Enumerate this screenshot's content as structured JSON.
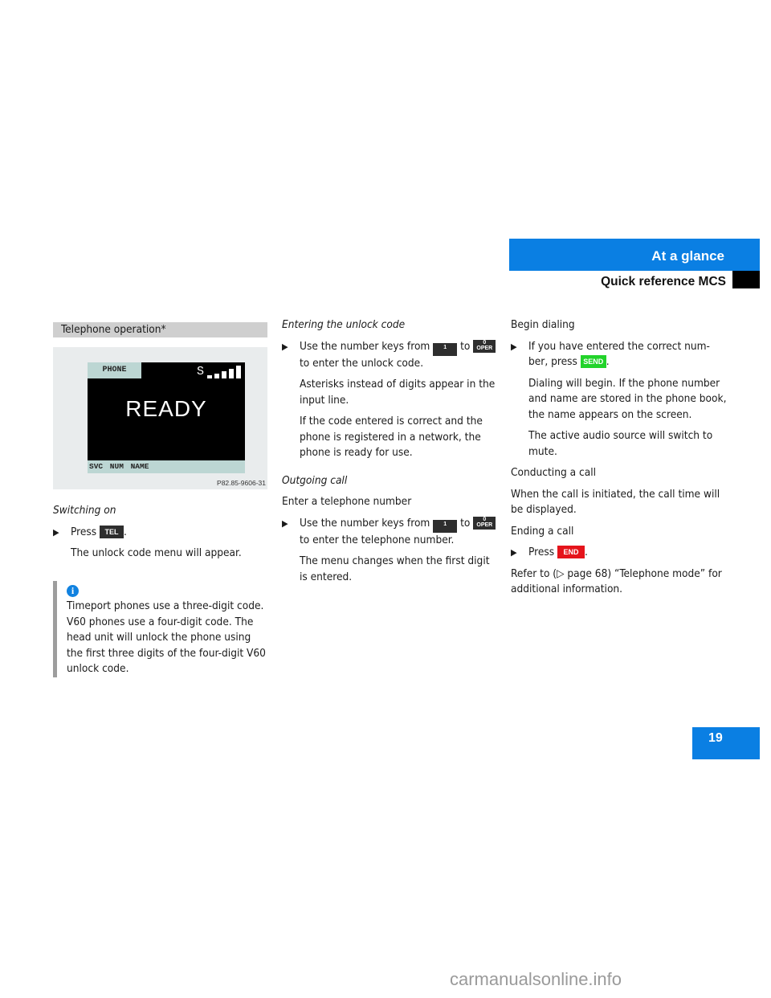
{
  "header": {
    "chapter": "At a glance",
    "section": "Quick reference MCS",
    "accent_color": "#0a7fe3"
  },
  "page_number": "19",
  "column1": {
    "section_title": "Telephone operation*",
    "figure": {
      "tab_label": "PHONE",
      "signal_label": "S",
      "signal_bars": 5,
      "status_text": "READY",
      "softkeys": "SVC NUM NAME",
      "figure_code": "P82.85-9606-31"
    },
    "switching_on": {
      "heading": "Switching on",
      "step_prefix": "Press",
      "key_label": "TEL",
      "step_suffix": ".",
      "result": "The unlock code menu will appear."
    },
    "note": {
      "icon": "info-icon",
      "text": "Timeport phones use a three-digit code. V60 phones use a four-digit code. The head unit will unlock the phone using the first three digits of the four-digit V60 unlock code."
    }
  },
  "column2": {
    "unlock": {
      "heading": "Entering the unlock code",
      "step_prefix": "Use the number keys from",
      "key_from": "1",
      "step_mid": "to",
      "key_to_top": "0",
      "key_to_bottom": "OPER",
      "step_suffix": "to enter the unlock code.",
      "para1": "Asterisks instead of digits appear in the input line.",
      "para2": "If the code entered is correct and the phone is registered in a network, the phone is ready for use."
    },
    "outgoing": {
      "heading": "Outgoing call",
      "intro": "Enter a telephone number",
      "step_prefix": "Use the number keys from",
      "key_from": "1",
      "step_mid": "to",
      "key_to_top": "0",
      "key_to_bottom": "OPER",
      "step_suffix": "to enter the telephone number.",
      "para": "The menu changes when the first digit is entered."
    }
  },
  "column3": {
    "begin_dialing": "Begin dialing",
    "send_step_prefix": "If you have entered the correct num-ber, press",
    "send_key": "SEND",
    "send_step_suffix": ".",
    "dialing_para1": "Dialing will begin. If the phone number and name are stored in the phone book, the name appears on the screen.",
    "dialing_para2": "The active audio source will switch to mute.",
    "conducting_heading": "Conducting a call",
    "conducting_text": "When the call is initiated, the call time will be displayed.",
    "ending_heading": "Ending a call",
    "end_step_prefix": "Press",
    "end_key": "END",
    "end_step_suffix": ".",
    "refer_text": "Refer to (▷ page 68) “Telephone mode” for additional information.",
    "send_color": "#22d32a",
    "end_color": "#e5141b"
  },
  "watermark": "carmanualsonline.info"
}
